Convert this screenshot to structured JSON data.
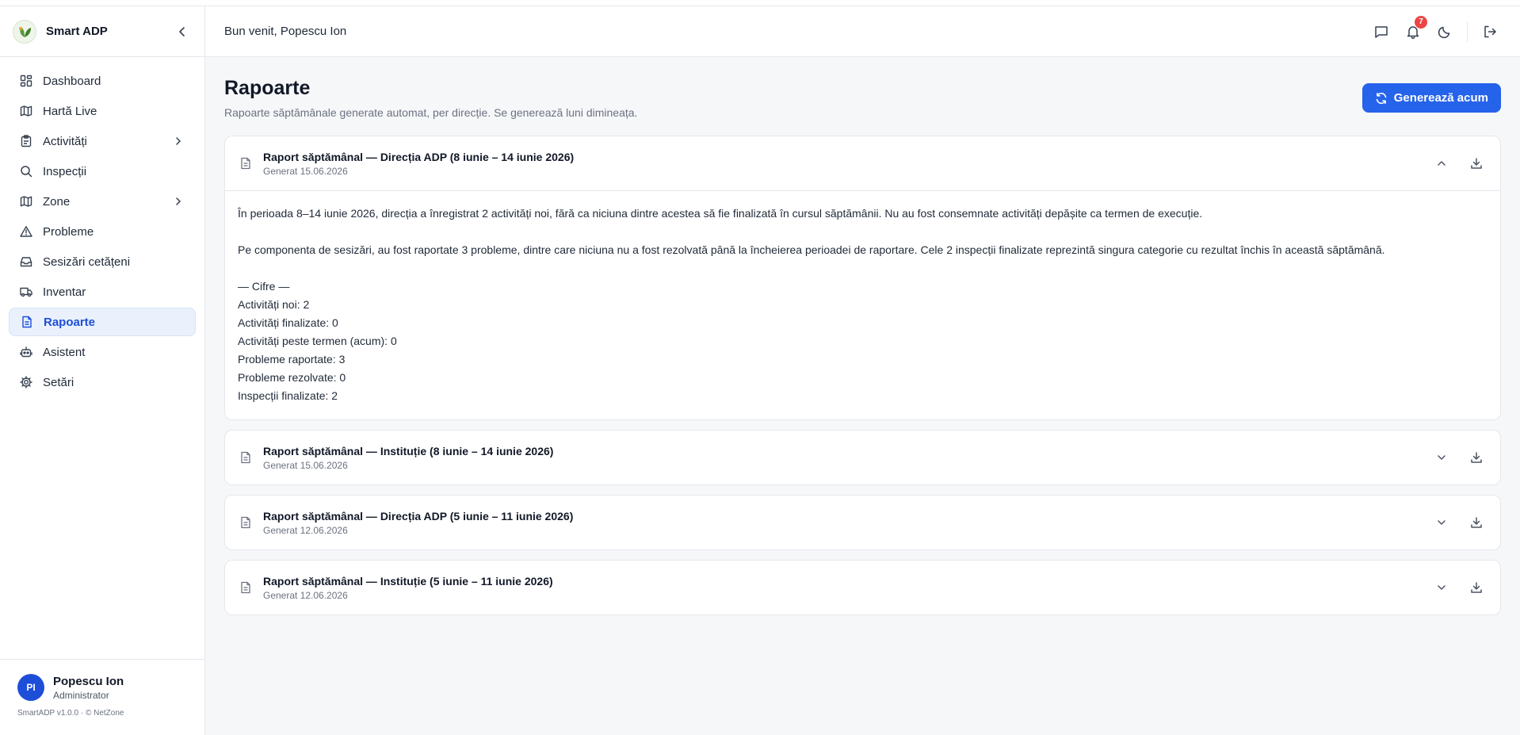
{
  "app": {
    "name": "Smart ADP",
    "version": "SmartADP v1.0.0 · © NetZone"
  },
  "sidebar": {
    "items": [
      {
        "label": "Dashboard",
        "icon": "dashboard-icon"
      },
      {
        "label": "Hartă Live",
        "icon": "map-icon"
      },
      {
        "label": "Activități",
        "icon": "clipboard-icon",
        "expandable": true
      },
      {
        "label": "Inspecții",
        "icon": "search-icon"
      },
      {
        "label": "Zone",
        "icon": "map-icon",
        "expandable": true
      },
      {
        "label": "Probleme",
        "icon": "warning-icon"
      },
      {
        "label": "Sesizări cetățeni",
        "icon": "inbox-icon"
      },
      {
        "label": "Inventar",
        "icon": "truck-icon"
      },
      {
        "label": "Rapoarte",
        "icon": "report-icon",
        "active": true
      },
      {
        "label": "Asistent",
        "icon": "bot-icon"
      },
      {
        "label": "Setări",
        "icon": "gear-icon"
      }
    ]
  },
  "user": {
    "initials": "PI",
    "name": "Popescu Ion",
    "role": "Administrator"
  },
  "header": {
    "welcome": "Bun venit, Popescu Ion",
    "notifications_count": "7"
  },
  "page": {
    "title": "Rapoarte",
    "subtitle": "Rapoarte săptămânale generate automat, per direcție. Se generează luni dimineața.",
    "generate_label": "Generează acum"
  },
  "reports": [
    {
      "title": "Raport săptămânal — Direcția ADP (8 iunie – 14 iunie 2026)",
      "date": "Generat 15.06.2026",
      "expanded": true,
      "body": {
        "p1": "În perioada 8–14 iunie 2026, direcția a înregistrat 2 activități noi, fără ca niciuna dintre acestea să fie finalizată în cursul săptămânii. Nu au fost consemnate activități depășite ca termen de execuție.",
        "p2": "Pe componenta de sesizări, au fost raportate 3 probleme, dintre care niciuna nu a fost rezolvată până la încheierea perioadei de raportare. Cele 2 inspecții finalizate reprezintă singura categorie cu rezultat închis în această săptămână.",
        "lines": [
          "— Cifre —",
          "Activități noi: 2",
          "Activități finalizate: 0",
          "Activități peste termen (acum): 0",
          "Probleme raportate: 3",
          "Probleme rezolvate: 0",
          "Inspecții finalizate: 2"
        ]
      }
    },
    {
      "title": "Raport săptămânal — Instituție (8 iunie – 14 iunie 2026)",
      "date": "Generat 15.06.2026",
      "expanded": false
    },
    {
      "title": "Raport săptămânal — Direcția ADP (5 iunie – 11 iunie 2026)",
      "date": "Generat 12.06.2026",
      "expanded": false
    },
    {
      "title": "Raport săptămânal — Instituție (5 iunie – 11 iunie 2026)",
      "date": "Generat 12.06.2026",
      "expanded": false
    }
  ],
  "colors": {
    "accent": "#2563eb",
    "active_bg": "#eaf1fc",
    "badge": "#ef4444"
  }
}
